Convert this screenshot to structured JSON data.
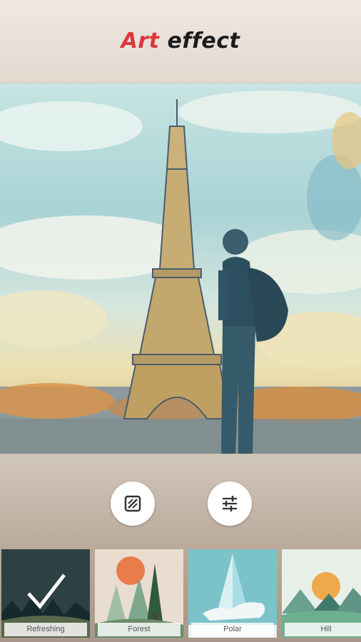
{
  "header": {
    "title_accent": "Art",
    "title_rest": "effect"
  },
  "photo": {
    "description_icon": "eiffel-tower-artwork"
  },
  "tools": [
    {
      "icon": "eraser-icon"
    },
    {
      "icon": "adjust-sliders-icon"
    }
  ],
  "filters": [
    {
      "label": "Refreshing",
      "selected": true
    },
    {
      "label": "Forest",
      "selected": false
    },
    {
      "label": "Polar",
      "selected": false
    },
    {
      "label": "Hill",
      "selected": false
    }
  ],
  "colors": {
    "accent": "#e0353d",
    "title": "#1c1c1c"
  }
}
